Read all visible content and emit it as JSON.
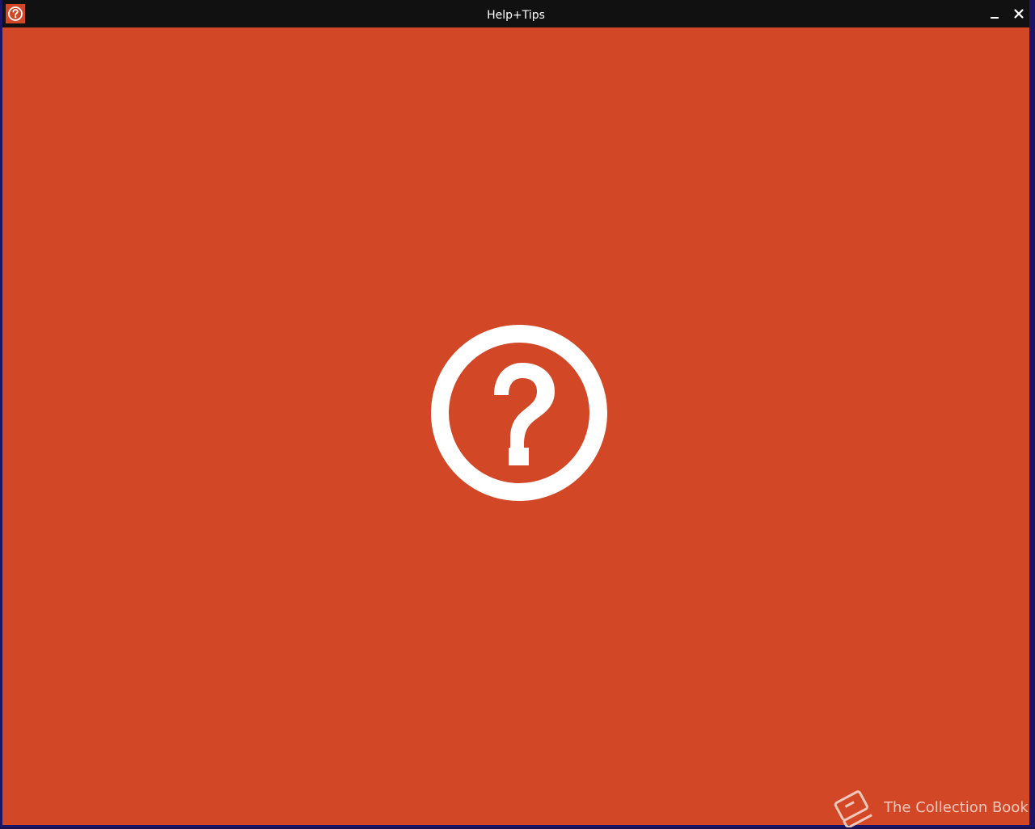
{
  "window": {
    "title": "Help+Tips",
    "app_icon": "help-circle-icon"
  },
  "titlebar_controls": {
    "minimize_icon": "minimize-icon",
    "close_icon": "close-icon"
  },
  "splash": {
    "icon": "question-circle-icon",
    "background_color": "#d24726"
  },
  "watermark": {
    "icon": "book-icon",
    "text": "The Collection Book"
  }
}
